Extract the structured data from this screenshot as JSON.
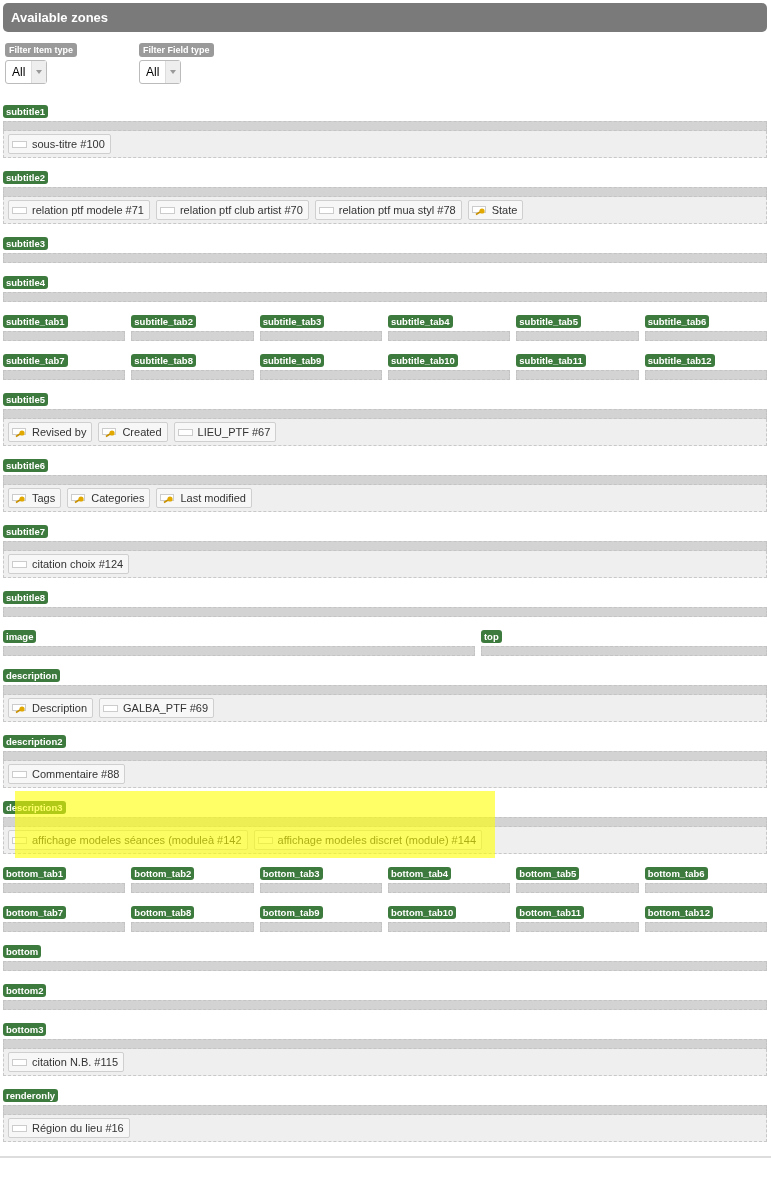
{
  "header": {
    "title": "Available zones"
  },
  "filters": [
    {
      "label": "Filter Item type",
      "value": "All"
    },
    {
      "label": "Filter Field type",
      "value": "All"
    }
  ],
  "rows": [
    [
      {
        "label": "subtitle1",
        "highlighted": false,
        "items": [
          {
            "kind": "field",
            "label": "sous-titre #100"
          }
        ]
      }
    ],
    [
      {
        "label": "subtitle2",
        "highlighted": false,
        "items": [
          {
            "kind": "field",
            "label": "relation ptf modele #71"
          },
          {
            "kind": "field",
            "label": "relation ptf club artist #70"
          },
          {
            "kind": "field",
            "label": "relation ptf mua styl #78"
          },
          {
            "kind": "key",
            "label": "State"
          }
        ]
      }
    ],
    [
      {
        "label": "subtitle3",
        "highlighted": false
      }
    ],
    [
      {
        "label": "subtitle4",
        "highlighted": false
      }
    ],
    [
      {
        "label": "subtitle_tab1",
        "highlighted": false
      },
      {
        "label": "subtitle_tab2",
        "highlighted": false
      },
      {
        "label": "subtitle_tab3",
        "highlighted": false
      },
      {
        "label": "subtitle_tab4",
        "highlighted": false
      },
      {
        "label": "subtitle_tab5",
        "highlighted": false
      },
      {
        "label": "subtitle_tab6",
        "highlighted": false
      }
    ],
    [
      {
        "label": "subtitle_tab7",
        "highlighted": false
      },
      {
        "label": "subtitle_tab8",
        "highlighted": false
      },
      {
        "label": "subtitle_tab9",
        "highlighted": false
      },
      {
        "label": "subtitle_tab10",
        "highlighted": false
      },
      {
        "label": "subtitle_tab11",
        "highlighted": false
      },
      {
        "label": "subtitle_tab12",
        "highlighted": false
      }
    ],
    [
      {
        "label": "subtitle5",
        "highlighted": false,
        "items": [
          {
            "kind": "key",
            "label": "Revised by"
          },
          {
            "kind": "key",
            "label": "Created"
          },
          {
            "kind": "field",
            "label": "LIEU_PTF #67"
          }
        ]
      }
    ],
    [
      {
        "label": "subtitle6",
        "highlighted": false,
        "items": [
          {
            "kind": "key",
            "label": "Tags"
          },
          {
            "kind": "key",
            "label": "Categories"
          },
          {
            "kind": "key",
            "label": "Last modified"
          }
        ]
      }
    ],
    [
      {
        "label": "subtitle7",
        "highlighted": false,
        "items": [
          {
            "kind": "field",
            "label": "citation choix #124"
          }
        ]
      }
    ],
    [
      {
        "label": "subtitle8",
        "highlighted": false
      }
    ],
    [
      {
        "label": "image",
        "highlighted": false
      },
      {
        "label": "top",
        "highlighted": false
      }
    ],
    [
      {
        "label": "description",
        "highlighted": false,
        "items": [
          {
            "kind": "key",
            "label": "Description"
          },
          {
            "kind": "field",
            "label": "GALBA_PTF #69"
          }
        ]
      }
    ],
    [
      {
        "label": "description2",
        "highlighted": false,
        "items": [
          {
            "kind": "field",
            "label": "Commentaire #88"
          }
        ]
      }
    ],
    [
      {
        "label": "description3",
        "highlighted": true,
        "items": [
          {
            "kind": "field",
            "label": "affichage modeles séances (moduleà #142"
          },
          {
            "kind": "field",
            "label": "affichage modeles discret (module) #144"
          }
        ]
      }
    ],
    [
      {
        "label": "bottom_tab1",
        "highlighted": false
      },
      {
        "label": "bottom_tab2",
        "highlighted": false
      },
      {
        "label": "bottom_tab3",
        "highlighted": false
      },
      {
        "label": "bottom_tab4",
        "highlighted": false
      },
      {
        "label": "bottom_tab5",
        "highlighted": false
      },
      {
        "label": "bottom_tab6",
        "highlighted": false
      }
    ],
    [
      {
        "label": "bottom_tab7",
        "highlighted": false
      },
      {
        "label": "bottom_tab8",
        "highlighted": false
      },
      {
        "label": "bottom_tab9",
        "highlighted": false
      },
      {
        "label": "bottom_tab10",
        "highlighted": false
      },
      {
        "label": "bottom_tab11",
        "highlighted": false
      },
      {
        "label": "bottom_tab12",
        "highlighted": false
      }
    ],
    [
      {
        "label": "bottom",
        "highlighted": false
      }
    ],
    [
      {
        "label": "bottom2",
        "highlighted": false
      }
    ],
    [
      {
        "label": "bottom3",
        "highlighted": false,
        "items": [
          {
            "kind": "field",
            "label": "citation N.B. #115"
          }
        ]
      }
    ],
    [
      {
        "label": "renderonly",
        "highlighted": false,
        "items": [
          {
            "kind": "field",
            "label": "Région du lieu #16"
          }
        ]
      }
    ]
  ]
}
